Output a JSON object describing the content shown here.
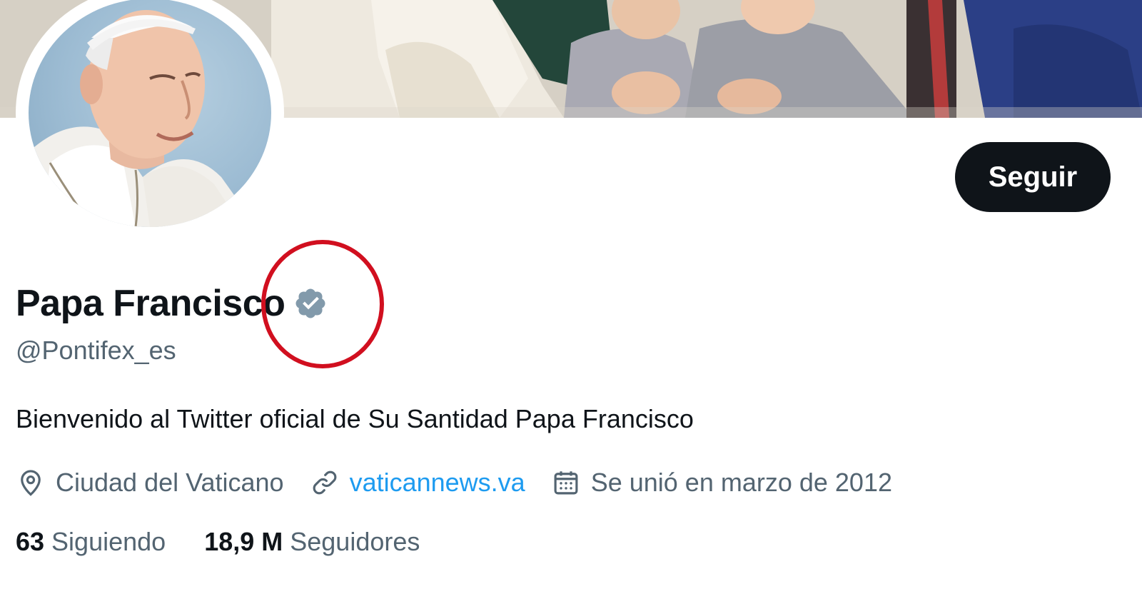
{
  "profile": {
    "display_name": "Papa Francisco",
    "handle": "@Pontifex_es",
    "bio": "Bienvenido al Twitter oficial de Su Santidad Papa Francisco",
    "location": "Ciudad del Vaticano",
    "website": "vaticannews.va",
    "joined": "Se unió en marzo de 2012",
    "verified_color": "#829aab"
  },
  "actions": {
    "follow_label": "Seguir"
  },
  "stats": {
    "following_count": "63",
    "following_label": "Siguiendo",
    "followers_count": "18,9 M",
    "followers_label": "Seguidores"
  },
  "colors": {
    "primary_text": "#0f1419",
    "secondary_text": "#536471",
    "link": "#1d9bf0",
    "button_bg": "#0f1419",
    "annotation": "#d10f1f"
  },
  "icons": {
    "verified": "verified-badge-icon",
    "location": "location-pin-icon",
    "link": "link-icon",
    "calendar": "calendar-icon"
  }
}
